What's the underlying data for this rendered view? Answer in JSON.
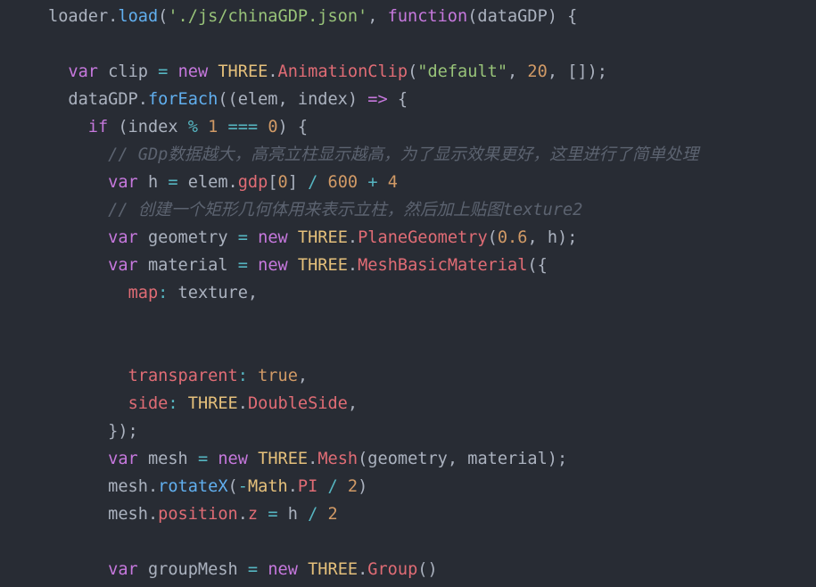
{
  "theme": {
    "background": "#282c34",
    "text": "#abb2bf",
    "keyword": "#c678dd",
    "function": "#61afef",
    "string": "#98c379",
    "number": "#d19a66",
    "class": "#e5c07b",
    "property": "#e06c75",
    "operator": "#56b6c2",
    "comment": "#5c6370"
  },
  "lines": [
    {
      "indent": "",
      "tokens": [
        {
          "t": "txt",
          "v": "loader"
        },
        {
          "t": "txt",
          "v": "."
        },
        {
          "t": "fn",
          "v": "load"
        },
        {
          "t": "txt",
          "v": "("
        },
        {
          "t": "str",
          "v": "'./js/chinaGDP.json'"
        },
        {
          "t": "txt",
          "v": ", "
        },
        {
          "t": "kw",
          "v": "function"
        },
        {
          "t": "txt",
          "v": "(dataGDP) {"
        }
      ]
    },
    {
      "indent": "",
      "tokens": []
    },
    {
      "indent": "  ",
      "tokens": [
        {
          "t": "kw",
          "v": "var"
        },
        {
          "t": "txt",
          "v": " clip "
        },
        {
          "t": "op",
          "v": "="
        },
        {
          "t": "txt",
          "v": " "
        },
        {
          "t": "kw",
          "v": "new"
        },
        {
          "t": "txt",
          "v": " "
        },
        {
          "t": "cls",
          "v": "THREE"
        },
        {
          "t": "txt",
          "v": "."
        },
        {
          "t": "prop",
          "v": "AnimationClip"
        },
        {
          "t": "txt",
          "v": "("
        },
        {
          "t": "str",
          "v": "\"default\""
        },
        {
          "t": "txt",
          "v": ", "
        },
        {
          "t": "num",
          "v": "20"
        },
        {
          "t": "txt",
          "v": ", []);"
        }
      ]
    },
    {
      "indent": "  ",
      "tokens": [
        {
          "t": "txt",
          "v": "dataGDP."
        },
        {
          "t": "fn",
          "v": "forEach"
        },
        {
          "t": "txt",
          "v": "((elem, index) "
        },
        {
          "t": "kw",
          "v": "=>"
        },
        {
          "t": "txt",
          "v": " {"
        }
      ]
    },
    {
      "indent": "    ",
      "tokens": [
        {
          "t": "kw",
          "v": "if"
        },
        {
          "t": "txt",
          "v": " (index "
        },
        {
          "t": "op",
          "v": "%"
        },
        {
          "t": "txt",
          "v": " "
        },
        {
          "t": "num",
          "v": "1"
        },
        {
          "t": "txt",
          "v": " "
        },
        {
          "t": "op",
          "v": "==="
        },
        {
          "t": "txt",
          "v": " "
        },
        {
          "t": "num",
          "v": "0"
        },
        {
          "t": "txt",
          "v": ") {"
        }
      ]
    },
    {
      "indent": "      ",
      "tokens": [
        {
          "t": "cmt",
          "v": "// GDp数据越大，高亮立柱显示越高，为了显示效果更好，这里进行了简单处理"
        }
      ]
    },
    {
      "indent": "      ",
      "tokens": [
        {
          "t": "kw",
          "v": "var"
        },
        {
          "t": "txt",
          "v": " h "
        },
        {
          "t": "op",
          "v": "="
        },
        {
          "t": "txt",
          "v": " elem."
        },
        {
          "t": "prop",
          "v": "gdp"
        },
        {
          "t": "txt",
          "v": "["
        },
        {
          "t": "num",
          "v": "0"
        },
        {
          "t": "txt",
          "v": "] "
        },
        {
          "t": "op",
          "v": "/"
        },
        {
          "t": "txt",
          "v": " "
        },
        {
          "t": "num",
          "v": "600"
        },
        {
          "t": "txt",
          "v": " "
        },
        {
          "t": "op",
          "v": "+"
        },
        {
          "t": "txt",
          "v": " "
        },
        {
          "t": "num",
          "v": "4"
        }
      ]
    },
    {
      "indent": "      ",
      "tokens": [
        {
          "t": "cmt",
          "v": "// 创建一个矩形几何体用来表示立柱，然后加上贴图texture2"
        }
      ]
    },
    {
      "indent": "      ",
      "tokens": [
        {
          "t": "kw",
          "v": "var"
        },
        {
          "t": "txt",
          "v": " geometry "
        },
        {
          "t": "op",
          "v": "="
        },
        {
          "t": "txt",
          "v": " "
        },
        {
          "t": "kw",
          "v": "new"
        },
        {
          "t": "txt",
          "v": " "
        },
        {
          "t": "cls",
          "v": "THREE"
        },
        {
          "t": "txt",
          "v": "."
        },
        {
          "t": "prop",
          "v": "PlaneGeometry"
        },
        {
          "t": "txt",
          "v": "("
        },
        {
          "t": "num",
          "v": "0.6"
        },
        {
          "t": "txt",
          "v": ", h);"
        }
      ]
    },
    {
      "indent": "      ",
      "tokens": [
        {
          "t": "kw",
          "v": "var"
        },
        {
          "t": "txt",
          "v": " material "
        },
        {
          "t": "op",
          "v": "="
        },
        {
          "t": "txt",
          "v": " "
        },
        {
          "t": "kw",
          "v": "new"
        },
        {
          "t": "txt",
          "v": " "
        },
        {
          "t": "cls",
          "v": "THREE"
        },
        {
          "t": "txt",
          "v": "."
        },
        {
          "t": "prop",
          "v": "MeshBasicMaterial"
        },
        {
          "t": "txt",
          "v": "({"
        }
      ]
    },
    {
      "indent": "        ",
      "tokens": [
        {
          "t": "prop",
          "v": "map"
        },
        {
          "t": "op",
          "v": ":"
        },
        {
          "t": "txt",
          "v": " texture,"
        }
      ]
    },
    {
      "indent": "",
      "tokens": []
    },
    {
      "indent": "",
      "tokens": []
    },
    {
      "indent": "        ",
      "tokens": [
        {
          "t": "prop",
          "v": "transparent"
        },
        {
          "t": "op",
          "v": ":"
        },
        {
          "t": "txt",
          "v": " "
        },
        {
          "t": "num",
          "v": "true"
        },
        {
          "t": "txt",
          "v": ","
        }
      ]
    },
    {
      "indent": "        ",
      "tokens": [
        {
          "t": "prop",
          "v": "side"
        },
        {
          "t": "op",
          "v": ":"
        },
        {
          "t": "txt",
          "v": " "
        },
        {
          "t": "cls",
          "v": "THREE"
        },
        {
          "t": "txt",
          "v": "."
        },
        {
          "t": "prop",
          "v": "DoubleSide"
        },
        {
          "t": "txt",
          "v": ","
        }
      ]
    },
    {
      "indent": "      ",
      "tokens": [
        {
          "t": "txt",
          "v": "});"
        }
      ]
    },
    {
      "indent": "      ",
      "tokens": [
        {
          "t": "kw",
          "v": "var"
        },
        {
          "t": "txt",
          "v": " mesh "
        },
        {
          "t": "op",
          "v": "="
        },
        {
          "t": "txt",
          "v": " "
        },
        {
          "t": "kw",
          "v": "new"
        },
        {
          "t": "txt",
          "v": " "
        },
        {
          "t": "cls",
          "v": "THREE"
        },
        {
          "t": "txt",
          "v": "."
        },
        {
          "t": "prop",
          "v": "Mesh"
        },
        {
          "t": "txt",
          "v": "(geometry, material);"
        }
      ]
    },
    {
      "indent": "      ",
      "tokens": [
        {
          "t": "txt",
          "v": "mesh."
        },
        {
          "t": "fn",
          "v": "rotateX"
        },
        {
          "t": "txt",
          "v": "("
        },
        {
          "t": "op",
          "v": "-"
        },
        {
          "t": "cls",
          "v": "Math"
        },
        {
          "t": "txt",
          "v": "."
        },
        {
          "t": "prop",
          "v": "PI"
        },
        {
          "t": "txt",
          "v": " "
        },
        {
          "t": "op",
          "v": "/"
        },
        {
          "t": "txt",
          "v": " "
        },
        {
          "t": "num",
          "v": "2"
        },
        {
          "t": "txt",
          "v": ")"
        }
      ]
    },
    {
      "indent": "      ",
      "tokens": [
        {
          "t": "txt",
          "v": "mesh."
        },
        {
          "t": "prop",
          "v": "position"
        },
        {
          "t": "txt",
          "v": "."
        },
        {
          "t": "prop",
          "v": "z"
        },
        {
          "t": "txt",
          "v": " "
        },
        {
          "t": "op",
          "v": "="
        },
        {
          "t": "txt",
          "v": " h "
        },
        {
          "t": "op",
          "v": "/"
        },
        {
          "t": "txt",
          "v": " "
        },
        {
          "t": "num",
          "v": "2"
        }
      ]
    },
    {
      "indent": "",
      "tokens": []
    },
    {
      "indent": "      ",
      "tokens": [
        {
          "t": "kw",
          "v": "var"
        },
        {
          "t": "txt",
          "v": " groupMesh "
        },
        {
          "t": "op",
          "v": "="
        },
        {
          "t": "txt",
          "v": " "
        },
        {
          "t": "kw",
          "v": "new"
        },
        {
          "t": "txt",
          "v": " "
        },
        {
          "t": "cls",
          "v": "THREE"
        },
        {
          "t": "txt",
          "v": "."
        },
        {
          "t": "prop",
          "v": "Group"
        },
        {
          "t": "txt",
          "v": "()"
        }
      ]
    }
  ]
}
